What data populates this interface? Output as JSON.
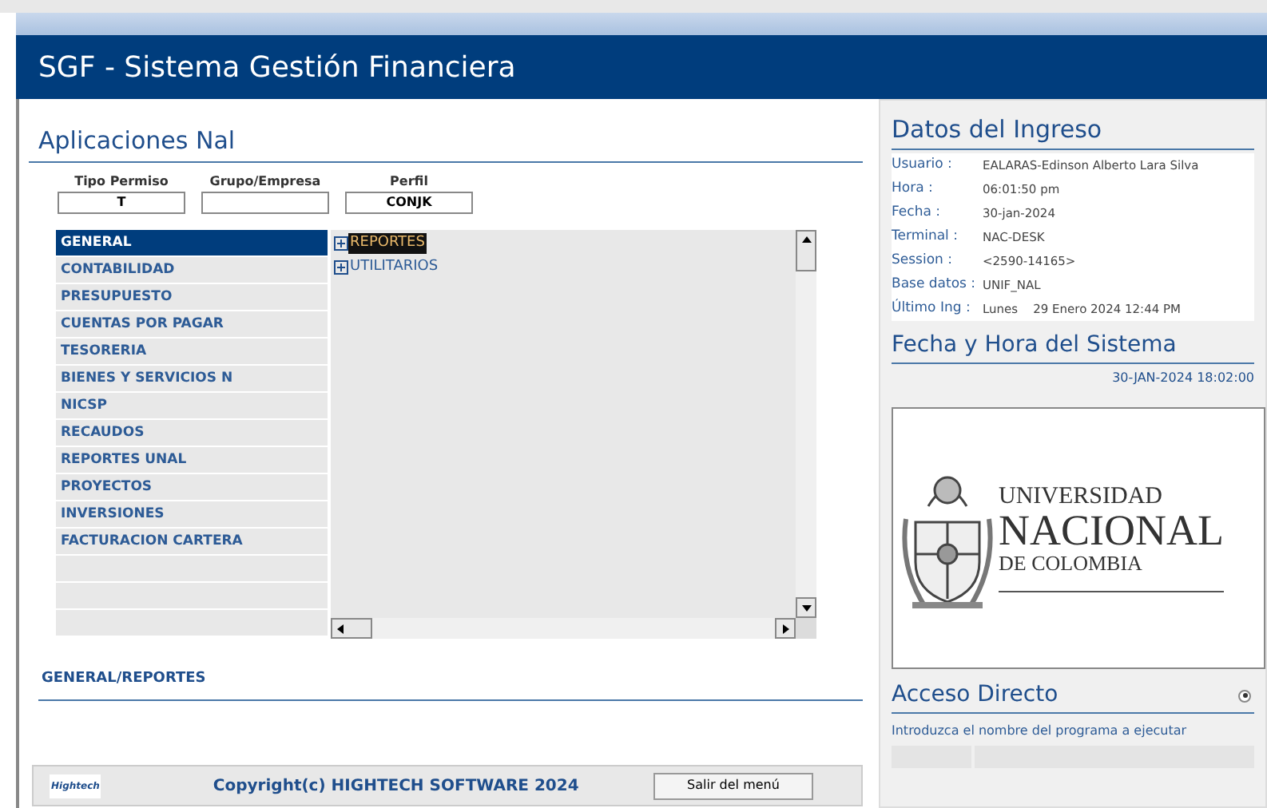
{
  "window": {
    "title": "SGF - Sistema Gestión Financiera"
  },
  "applications": {
    "heading": "Aplicaciones Nal",
    "fields": [
      {
        "label": "Tipo Permiso",
        "value": "T"
      },
      {
        "label": "Grupo/Empresa"
      },
      {
        "label": "Perfil",
        "value": "CONJK"
      }
    ],
    "modules": [
      {
        "label": "GENERAL",
        "selected": true
      },
      {
        "label": "CONTABILIDAD",
        "selected": false
      },
      {
        "label": "PRESUPUESTO",
        "selected": false
      },
      {
        "label": "CUENTAS POR PAGAR",
        "selected": false
      },
      {
        "label": "TESORERIA",
        "selected": false
      },
      {
        "label": "BIENES Y SERVICIOS N",
        "selected": false
      },
      {
        "label": "NICSP",
        "selected": false
      },
      {
        "label": "RECAUDOS",
        "selected": false
      },
      {
        "label": "REPORTES UNAL",
        "selected": false
      },
      {
        "label": "PROYECTOS",
        "selected": false
      },
      {
        "label": "INVERSIONES",
        "selected": false
      },
      {
        "label": "FACTURACION CARTERA",
        "selected": false
      }
    ],
    "tree": [
      {
        "label": "REPORTES",
        "selected": true,
        "expanded": false
      },
      {
        "label": "UTILITARIOS",
        "selected": false,
        "expanded": false
      }
    ],
    "breadcrumb": "GENERAL/REPORTES"
  },
  "footer": {
    "logo": "Hightech",
    "copyright": "Copyright(c) HIGHTECH SOFTWARE 2024",
    "exit_button": "Salir del menú"
  },
  "login_data": {
    "heading": "Datos del Ingreso",
    "rows": [
      {
        "label": "Usuario :",
        "value": "EALARAS-Edinson Alberto Lara Silva"
      },
      {
        "label": "Hora :",
        "value": "06:01:50 pm"
      },
      {
        "label": "Fecha :",
        "value": "30-jan-2024"
      },
      {
        "label": "Terminal :",
        "value": "NAC-DESK"
      },
      {
        "label": "Session :",
        "value": "<2590-14165>"
      },
      {
        "label": "Base datos :",
        "value": "UNIF_NAL"
      },
      {
        "label": "Último Ing :",
        "value": "Lunes    29 Enero 2024 12:44 PM"
      }
    ]
  },
  "system_datetime": {
    "heading": "Fecha y Hora del Sistema",
    "value": "30-JAN-2024 18:02:00"
  },
  "university_logo": {
    "line_1": "UNIVERSIDAD",
    "line_2": "NACIONAL",
    "line_3": "DE COLOMBIA"
  },
  "direct_access": {
    "heading": "Acceso Directo",
    "selected": true,
    "hint": "Introduzca el nombre del programa a ejecutar"
  }
}
